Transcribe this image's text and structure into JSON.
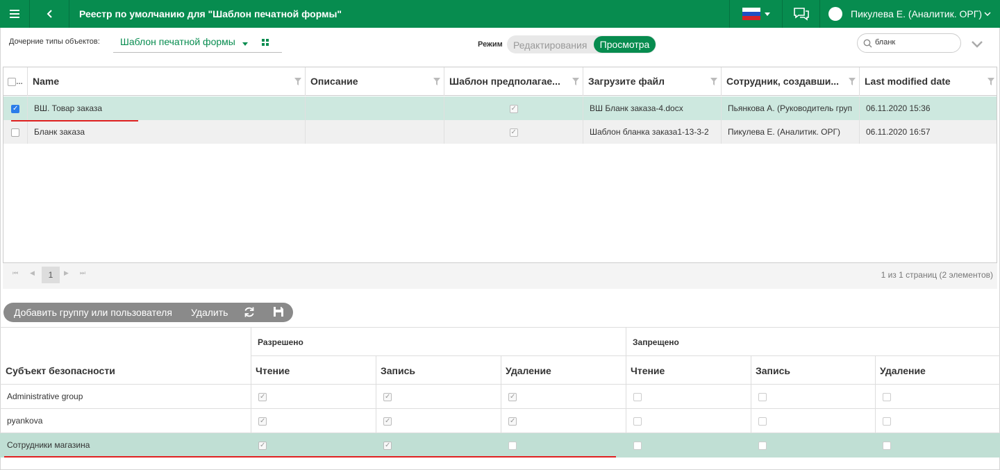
{
  "header": {
    "title": "Реестр по умолчанию для \"Шаблон печатной формы\"",
    "user_name": "Пикулева Е. (Аналитик. ОРГ)"
  },
  "toolbar": {
    "child_types_label": "Дочерние типы объектов:",
    "child_types_value": "Шаблон печатной формы",
    "mode_label": "Режим",
    "mode_edit": "Редактирования",
    "mode_view": "Просмотра",
    "search_value": "бланк"
  },
  "grid": {
    "columns": [
      "Name",
      "Описание",
      "Шаблон предполагае...",
      "Загрузите файл",
      "Сотрудник, создавши...",
      "Last modified date"
    ],
    "rows": [
      {
        "name": "ВШ. Товар заказа",
        "description": "",
        "template": true,
        "file": "ВШ Бланк заказа-4.docx",
        "employee": "Пьянкова А. (Руководитель груп",
        "modified": "06.11.2020 15:36",
        "selected": true
      },
      {
        "name": "Бланк заказа",
        "description": "",
        "template": true,
        "file": "Шаблон бланка заказа1-13-3-2",
        "employee": "Пикулева Е. (Аналитик. ОРГ)",
        "modified": "06.11.2020 16:57",
        "selected": false
      }
    ]
  },
  "pager": {
    "current_page": "1",
    "info": "1 из 1 страниц (2 элементов)"
  },
  "permissions": {
    "add_label": "Добавить группу или пользователя",
    "delete_label": "Удалить",
    "allowed_label": "Разрешено",
    "denied_label": "Запрещено",
    "subject_label": "Субъект безопасности",
    "read_label": "Чтение",
    "write_label": "Запись",
    "remove_label": "Удаление",
    "rows": [
      {
        "name": "Administrative group",
        "values": [
          true,
          true,
          true,
          false,
          false,
          false
        ]
      },
      {
        "name": "pyankova",
        "values": [
          true,
          true,
          true,
          false,
          false,
          false
        ]
      },
      {
        "name": "Сотрудники магазина",
        "values": [
          true,
          true,
          false,
          false,
          false,
          false
        ]
      }
    ]
  },
  "colors": {
    "accent": "#078c4f",
    "selected_row": "#cde8df",
    "highlight_row": "#c0dfd4",
    "annotation": "#e02020"
  }
}
